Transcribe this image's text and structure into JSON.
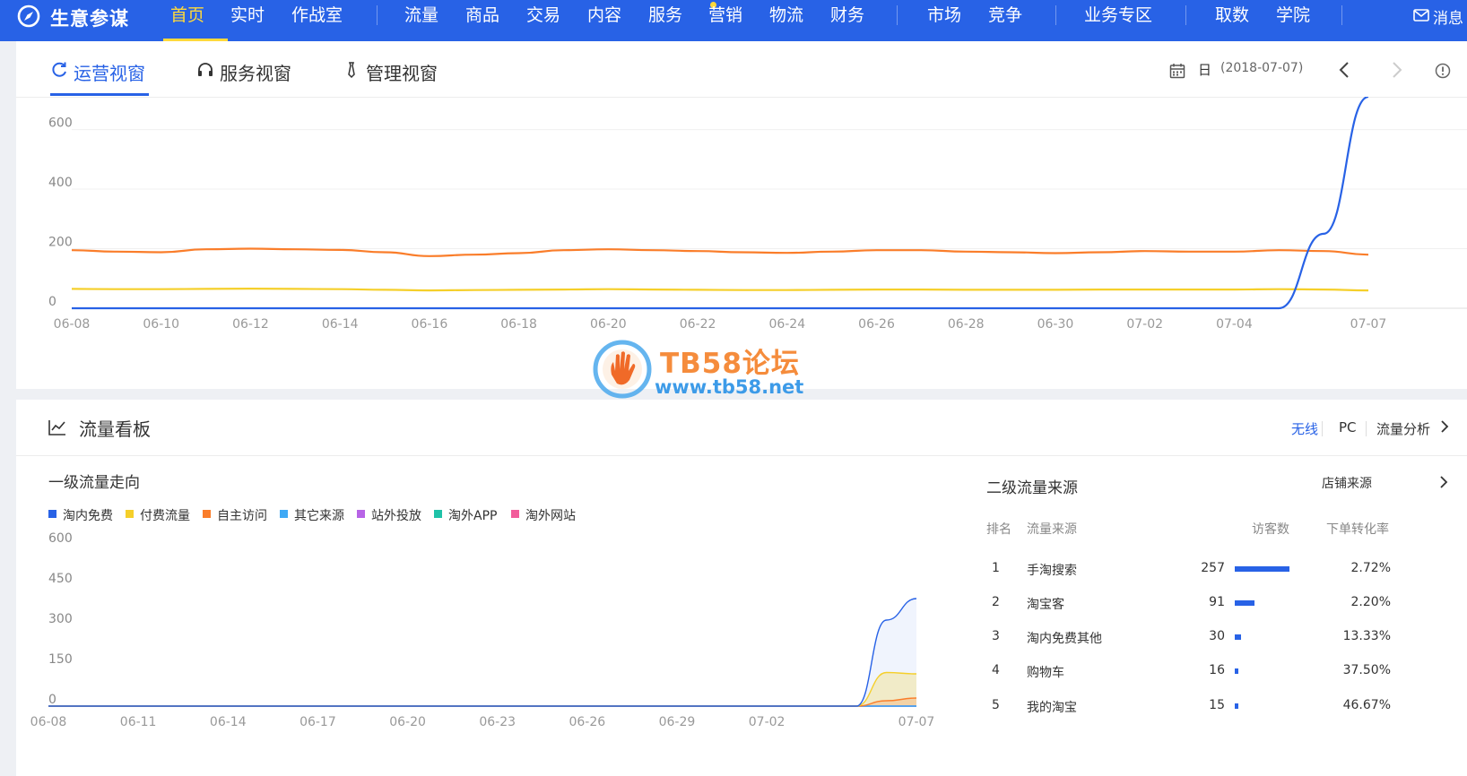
{
  "topnav": {
    "brand": "生意参谋",
    "items": [
      {
        "label": "首页",
        "active": true
      },
      {
        "label": "实时"
      },
      {
        "label": "作战室"
      },
      {
        "label": "流量"
      },
      {
        "label": "商品"
      },
      {
        "label": "交易"
      },
      {
        "label": "内容"
      },
      {
        "label": "服务"
      },
      {
        "label": "营销"
      },
      {
        "label": "物流"
      },
      {
        "label": "财务"
      },
      {
        "label": "市场"
      },
      {
        "label": "竞争"
      },
      {
        "label": "业务专区"
      },
      {
        "label": "取数"
      },
      {
        "label": "学院"
      }
    ],
    "message_label": "消息",
    "message_icon": "mail-icon",
    "logo_icon": "compass-icon",
    "accent_color": "#2862e6",
    "active_color": "#ffd93b"
  },
  "view_tabs": {
    "items": [
      {
        "label": "运营视窗",
        "icon": "refresh-circle-icon",
        "active": true
      },
      {
        "label": "服务视窗",
        "icon": "headset-icon"
      },
      {
        "label": "管理视窗",
        "icon": "tie-icon"
      }
    ],
    "date_label": "日",
    "date_value": "(2018-07-07)"
  },
  "chart_data": [
    {
      "type": "line",
      "title": "",
      "x": [
        "06-08",
        "06-09",
        "06-10",
        "06-11",
        "06-12",
        "06-13",
        "06-14",
        "06-15",
        "06-16",
        "06-17",
        "06-18",
        "06-19",
        "06-20",
        "06-21",
        "06-22",
        "06-23",
        "06-24",
        "06-25",
        "06-26",
        "06-27",
        "06-28",
        "06-29",
        "06-30",
        "07-01",
        "07-02",
        "07-03",
        "07-04",
        "07-05",
        "07-06",
        "07-07"
      ],
      "xticks": [
        "06-08",
        "06-10",
        "06-12",
        "06-14",
        "06-16",
        "06-18",
        "06-20",
        "06-22",
        "06-24",
        "06-26",
        "06-28",
        "06-30",
        "07-02",
        "07-04",
        "07-07"
      ],
      "yticks": [
        0,
        200,
        400,
        600
      ],
      "ylim": [
        0,
        710
      ],
      "grid": true,
      "series": [
        {
          "color": "#fa7d2a",
          "values": [
            195,
            190,
            188,
            198,
            200,
            198,
            196,
            188,
            175,
            180,
            185,
            195,
            198,
            195,
            192,
            188,
            186,
            190,
            195,
            195,
            190,
            188,
            185,
            188,
            192,
            190,
            190,
            195,
            192,
            180
          ]
        },
        {
          "color": "#f5cf2a",
          "values": [
            65,
            64,
            64,
            65,
            66,
            65,
            64,
            62,
            60,
            61,
            62,
            63,
            64,
            63,
            62,
            61,
            61,
            62,
            63,
            63,
            62,
            62,
            62,
            63,
            63,
            63,
            63,
            64,
            63,
            60
          ]
        },
        {
          "color": "#2862e6",
          "values": [
            0,
            0,
            0,
            0,
            0,
            0,
            0,
            0,
            0,
            0,
            0,
            0,
            0,
            0,
            0,
            0,
            0,
            0,
            0,
            0,
            0,
            0,
            0,
            0,
            0,
            0,
            0,
            0,
            250,
            710
          ]
        }
      ]
    },
    {
      "type": "area",
      "title": "一级流量走向",
      "x": [
        "06-08",
        "06-09",
        "06-10",
        "06-11",
        "06-12",
        "06-13",
        "06-14",
        "06-15",
        "06-16",
        "06-17",
        "06-18",
        "06-19",
        "06-20",
        "06-21",
        "06-22",
        "06-23",
        "06-24",
        "06-25",
        "06-26",
        "06-27",
        "06-28",
        "06-29",
        "06-30",
        "07-01",
        "07-02",
        "07-03",
        "07-04",
        "07-05",
        "07-06",
        "07-07"
      ],
      "xticks": [
        "06-08",
        "06-11",
        "06-14",
        "06-17",
        "06-20",
        "06-23",
        "06-26",
        "06-29",
        "07-02",
        "07-07"
      ],
      "yticks": [
        0,
        150,
        300,
        450,
        600
      ],
      "ylim": [
        0,
        600
      ],
      "legend_placement": "top-left",
      "series": [
        {
          "name": "淘内免费",
          "color": "#2862e6",
          "values": [
            0,
            0,
            0,
            0,
            0,
            0,
            0,
            0,
            0,
            0,
            0,
            0,
            0,
            0,
            0,
            0,
            0,
            0,
            0,
            0,
            0,
            0,
            0,
            0,
            0,
            0,
            0,
            0,
            320,
            400
          ]
        },
        {
          "name": "付费流量",
          "color": "#f5cf2a",
          "values": [
            0,
            0,
            0,
            0,
            0,
            0,
            0,
            0,
            0,
            0,
            0,
            0,
            0,
            0,
            0,
            0,
            0,
            0,
            0,
            0,
            0,
            0,
            0,
            0,
            0,
            0,
            0,
            0,
            125,
            120
          ]
        },
        {
          "name": "自主访问",
          "color": "#fa7d2a",
          "values": [
            0,
            0,
            0,
            0,
            0,
            0,
            0,
            0,
            0,
            0,
            0,
            0,
            0,
            0,
            0,
            0,
            0,
            0,
            0,
            0,
            0,
            0,
            0,
            0,
            0,
            0,
            0,
            0,
            20,
            30
          ]
        },
        {
          "name": "其它来源",
          "color": "#3fa9f5",
          "values": [
            0,
            0,
            0,
            0,
            0,
            0,
            0,
            0,
            0,
            0,
            0,
            0,
            0,
            0,
            0,
            0,
            0,
            0,
            0,
            0,
            0,
            0,
            0,
            0,
            0,
            0,
            0,
            0,
            0,
            0
          ]
        },
        {
          "name": "站外投放",
          "color": "#b764e6",
          "values": [
            0,
            0,
            0,
            0,
            0,
            0,
            0,
            0,
            0,
            0,
            0,
            0,
            0,
            0,
            0,
            0,
            0,
            0,
            0,
            0,
            0,
            0,
            0,
            0,
            0,
            0,
            0,
            0,
            0,
            0
          ]
        },
        {
          "name": "淘外APP",
          "color": "#1fc2a8",
          "values": [
            0,
            0,
            0,
            0,
            0,
            0,
            0,
            0,
            0,
            0,
            0,
            0,
            0,
            0,
            0,
            0,
            0,
            0,
            0,
            0,
            0,
            0,
            0,
            0,
            0,
            0,
            0,
            0,
            0,
            0
          ]
        },
        {
          "name": "淘外网站",
          "color": "#f25c9b",
          "values": [
            0,
            0,
            0,
            0,
            0,
            0,
            0,
            0,
            0,
            0,
            0,
            0,
            0,
            0,
            0,
            0,
            0,
            0,
            0,
            0,
            0,
            0,
            0,
            0,
            0,
            0,
            0,
            0,
            0,
            0
          ]
        }
      ]
    }
  ],
  "traffic_board": {
    "title": "流量看板",
    "links": {
      "wireless": "无线",
      "pc": "PC",
      "analysis": "流量分析"
    },
    "level1_title": "一级流量走向",
    "level2": {
      "title": "二级流量来源",
      "shop_source_link": "店铺来源",
      "headers": {
        "rank": "排名",
        "source": "流量来源",
        "visitors": "访客数",
        "conversion": "下单转化率"
      },
      "rows": [
        {
          "rank": "1",
          "source": "手淘搜索",
          "visitors": "257",
          "visitor_value": 257,
          "conversion": "2.72%"
        },
        {
          "rank": "2",
          "source": "淘宝客",
          "visitors": "91",
          "visitor_value": 91,
          "conversion": "2.20%"
        },
        {
          "rank": "3",
          "source": "淘内免费其他",
          "visitors": "30",
          "visitor_value": 30,
          "conversion": "13.33%"
        },
        {
          "rank": "4",
          "source": "购物车",
          "visitors": "16",
          "visitor_value": 16,
          "conversion": "37.50%"
        },
        {
          "rank": "5",
          "source": "我的淘宝",
          "visitors": "15",
          "visitor_value": 15,
          "conversion": "46.67%"
        }
      ]
    }
  },
  "watermark": {
    "title": "TB58论坛",
    "url": "www.tb58.net"
  }
}
